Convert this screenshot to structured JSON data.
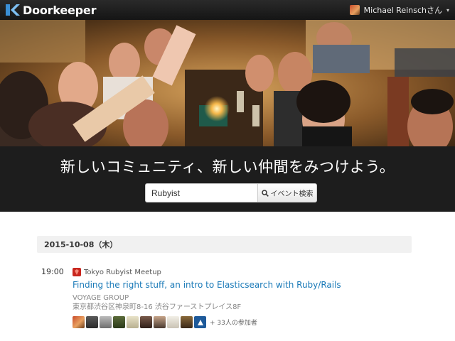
{
  "nav": {
    "brand": "Doorkeeper",
    "user_name": "Michael Reinschさん",
    "menu_caret": "▾"
  },
  "hero": {
    "tagline": "新しいコミュニティ、新しい仲間をみつけよう。",
    "search_value": "Rubyist",
    "search_button": "イベント検索"
  },
  "listing": {
    "date": "2015-10-08（木）",
    "events": [
      {
        "time": "19:00",
        "group": "Tokyo Rubyist Meetup",
        "title": "Finding the right stuff, an intro to Elasticsearch with Ruby/Rails",
        "venue_name": "VOYAGE GROUP",
        "venue_address": "東京都渋谷区神泉町8-16 渋谷ファーストプレイス8F",
        "attendees_more": "+ 33人の参加者"
      }
    ]
  },
  "colors": {
    "navbar": "#1f1f1f",
    "link": "#1a7ab8",
    "ruby": "#c8261e",
    "brand_blue": "#3a8fd6"
  }
}
